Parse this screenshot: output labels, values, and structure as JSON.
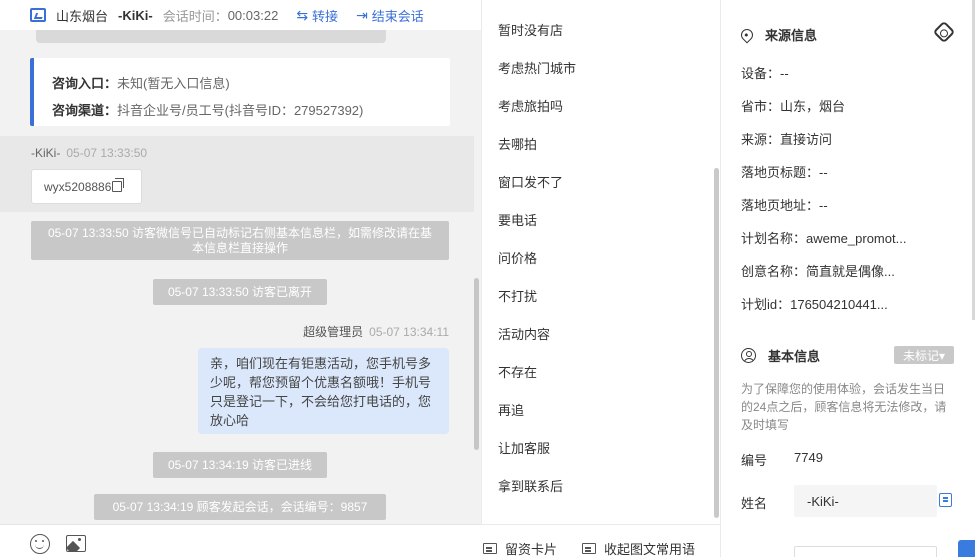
{
  "header": {
    "location": "山东烟台",
    "visitor_name": "-KiKi-",
    "session_time_label": "会话时间：",
    "session_time": "00:03:22",
    "transfer_label": "转接",
    "end_label": "结束会话"
  },
  "info_card": {
    "entry_key": "咨询入口：",
    "entry_value": "未知(暂无入口信息)",
    "channel_key": "咨询渠道：",
    "channel_value": "抖音企业号/员工号(抖音号ID：279527392)"
  },
  "messages": {
    "visitor_name": "-KiKi-",
    "visitor_time": "05-07 13:33:50",
    "wechat_id": "wyx5208886",
    "sys1": "05-07 13:33:50 访客微信号已自动标记右侧基本信息栏，如需修改请在基本信息栏直接操作",
    "sys2": "05-07 13:33:50 访客已离开",
    "admin_name": "超级管理员",
    "admin_time": "05-07 13:34:11",
    "admin_msg": "亲，咱们现在有钜惠活动，您手机号多少呢，帮您预留个优惠名额哦！手机号只是登记一下，不会给您打电话的，您放心哈",
    "sys3": "05-07 13:34:19 访客已进线",
    "sys4": "05-07 13:34:19 顾客发起会话，会话编号：9857"
  },
  "quick_replies": [
    "暂时没有店",
    "考虑热门城市",
    "考虑旅拍吗",
    "去哪拍",
    "窗口发不了",
    "要电话",
    "问价格",
    "不打扰",
    "活动内容",
    "不存在",
    "再追",
    "让加客服",
    "拿到联系后"
  ],
  "quick_footer": {
    "card_label": "留资卡片",
    "collapse_label": "收起图文常用语"
  },
  "source": {
    "title": "来源信息",
    "device": "设备：--",
    "province": "省市：山东，烟台",
    "origin": "来源：直接访问",
    "landing_title": "落地页标题：--",
    "landing_url": "落地页地址：--",
    "plan_name": "计划名称：aweme_promot...",
    "creative_name": "创意名称：简直就是偶像...",
    "plan_id": "计划id：176504210441..."
  },
  "basic": {
    "title": "基本信息",
    "tag": "未标记▾",
    "note": "为了保障您的使用体验，会话发生当日的24点之后，顾客信息将无法修改，请及时填写",
    "id_label": "编号",
    "id_value": "7749",
    "name_label": "姓名",
    "name_value": "-KiKi-"
  }
}
